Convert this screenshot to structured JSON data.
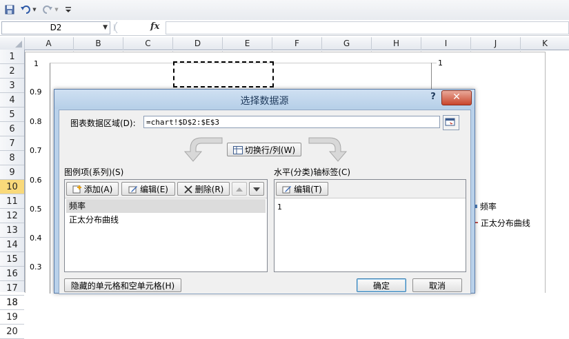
{
  "formula_bar": {
    "cell_ref": "D2",
    "fx_label": "fx",
    "formula": ""
  },
  "columns": [
    "A",
    "B",
    "C",
    "D",
    "E",
    "F",
    "G",
    "H",
    "I",
    "J",
    "K"
  ],
  "rows": [
    "1",
    "2",
    "3",
    "4",
    "5",
    "6",
    "7",
    "8",
    "9",
    "10",
    "11",
    "12",
    "13",
    "14",
    "15",
    "16",
    "17",
    "18",
    "19",
    "20"
  ],
  "selected_row": "10",
  "chart": {
    "y_ticks": [
      "1",
      "0.9",
      "0.8",
      "0.7",
      "0.6",
      "0.5",
      "0.4",
      "0.3"
    ],
    "secondary_y_top": "1",
    "legend": [
      {
        "label": "频率",
        "color": "#4f81bd"
      },
      {
        "label": "正太分布曲线",
        "color": "#c0504d"
      }
    ]
  },
  "dialog": {
    "title": "选择数据源",
    "help": "?",
    "close": "✕",
    "range_label": "图表数据区域(D):",
    "range_value": "=chart!$D$2:$E$3",
    "switch_button": "切换行/列(W)",
    "legend_section_label": "图例项(系列)(S)",
    "add_button": "添加(A)",
    "edit_button": "编辑(E)",
    "delete_button": "删除(R)",
    "series": [
      "频率",
      "正太分布曲线"
    ],
    "category_section_label": "水平(分类)轴标签(C)",
    "category_edit_button": "编辑(T)",
    "categories": [
      "1"
    ],
    "hidden_cells_button": "隐藏的单元格和空单元格(H)",
    "ok_button": "确定",
    "cancel_button": "取消"
  }
}
